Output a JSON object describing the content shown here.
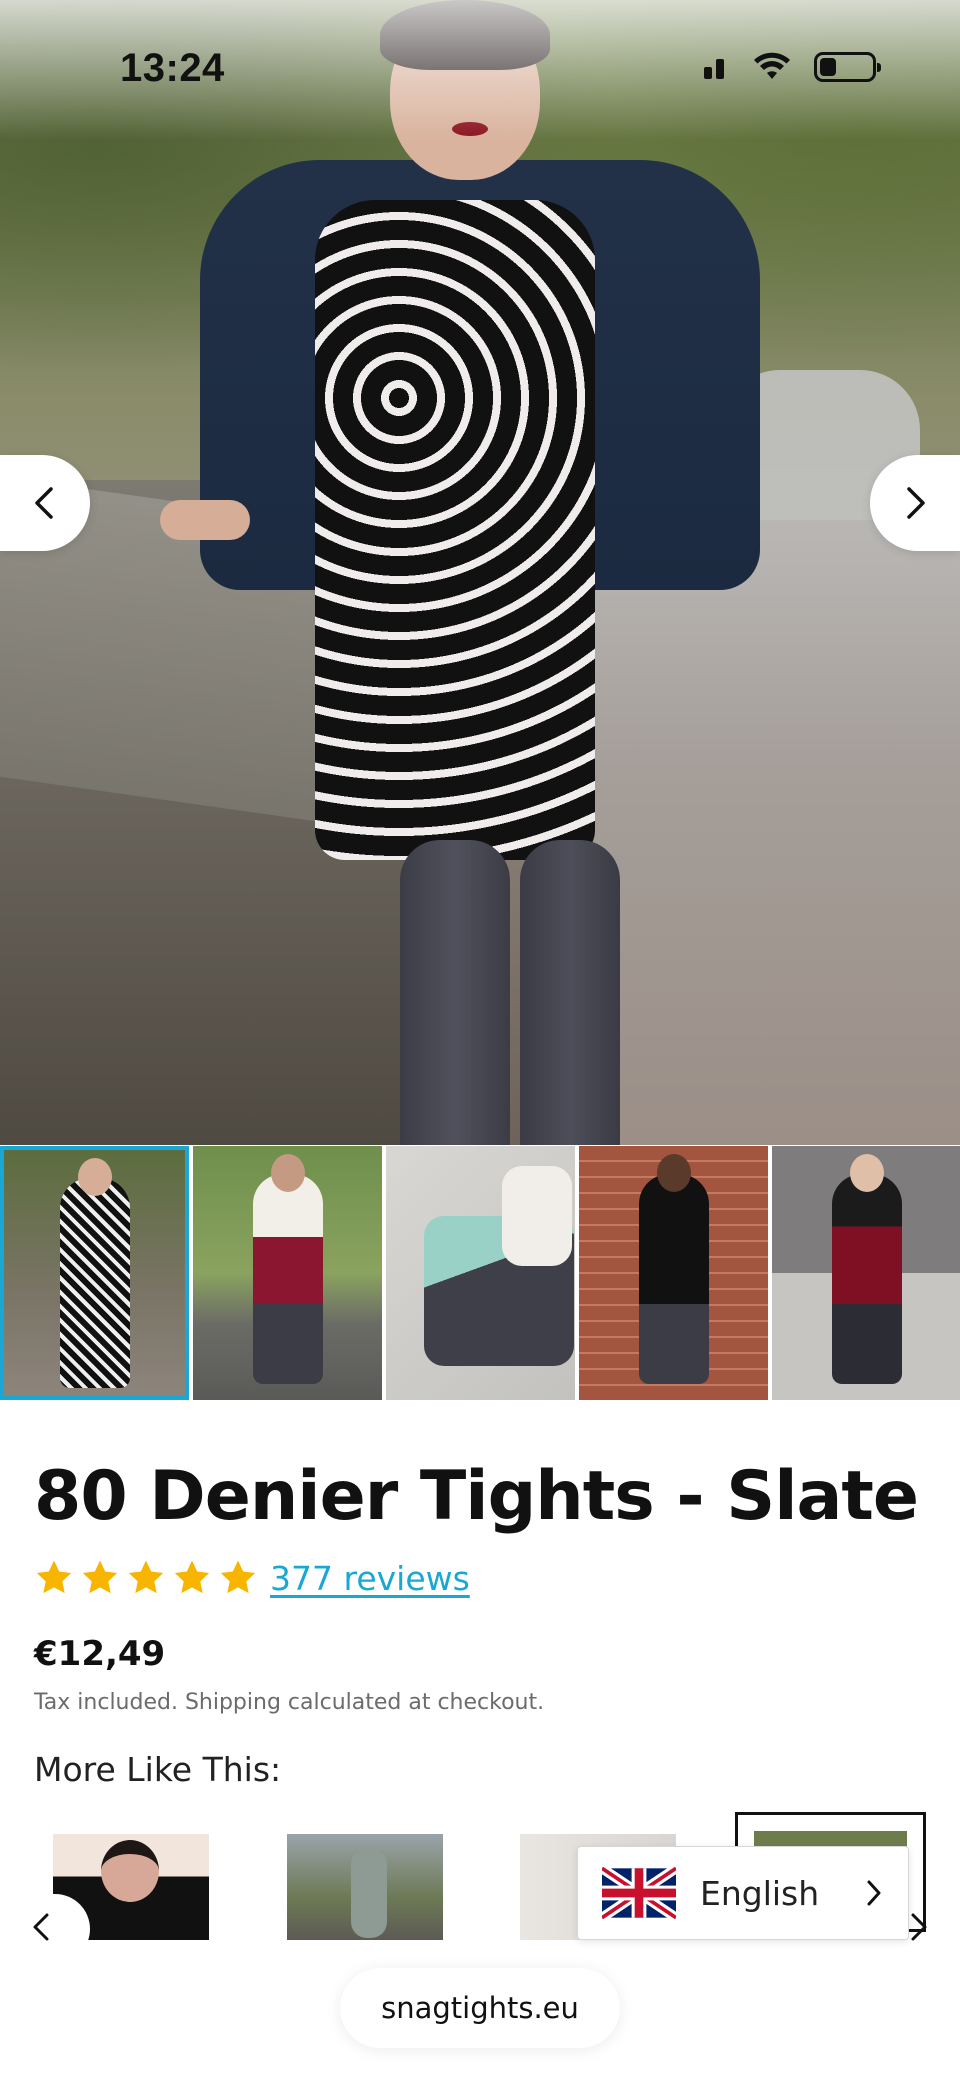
{
  "status_bar": {
    "time": "13:24"
  },
  "product": {
    "title": "80 Denier Tights - Slate",
    "rating_stars": 5,
    "reviews_label": "377 reviews",
    "price": "€12,49",
    "tax_note": "Tax included. Shipping calculated at checkout."
  },
  "gallery": {
    "thumbnail_count": 5,
    "active_index": 0
  },
  "more_section": {
    "title": "More Like This:"
  },
  "language": {
    "label": "English"
  },
  "browser": {
    "url": "snagtights.eu"
  },
  "colors": {
    "accent": "#1ba7d4",
    "star": "#f7b500"
  }
}
